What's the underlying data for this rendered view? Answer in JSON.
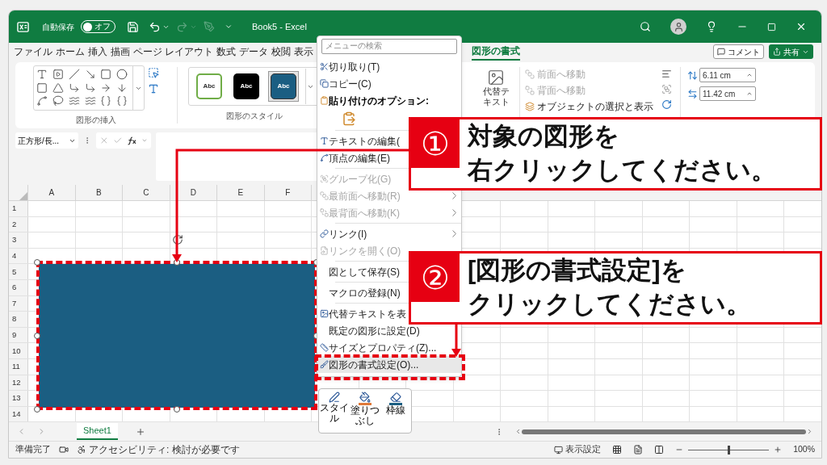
{
  "title_bar": {
    "autosave_label": "自動保存",
    "autosave_toggle": {
      "label": "オフ",
      "on": false
    },
    "title": "Book5 - Excel"
  },
  "ribbon_tabs": [
    {
      "label": "ファイル",
      "selected": false
    },
    {
      "label": "ホーム",
      "selected": false
    },
    {
      "label": "挿入",
      "selected": false
    },
    {
      "label": "描画",
      "selected": false
    },
    {
      "label": "ページ レイアウト",
      "selected": false
    },
    {
      "label": "数式",
      "selected": false
    },
    {
      "label": "データ",
      "selected": false
    },
    {
      "label": "校閲",
      "selected": false
    },
    {
      "label": "表示",
      "selected": false
    },
    {
      "label": "図形の書式",
      "selected": true
    }
  ],
  "header_buttons": {
    "comment": "コメント",
    "share": "共有"
  },
  "ribbon": {
    "insert_shapes_label": "図形の挿入",
    "shape_styles": [
      {
        "label": "Abc",
        "kind": "outline",
        "selected": false
      },
      {
        "label": "Abc",
        "kind": "black",
        "selected": false
      },
      {
        "label": "Abc",
        "kind": "filled",
        "selected": true
      }
    ],
    "shape_styles_label": "図形のスタイル",
    "alt_text": "代替テキスト",
    "arrange": [
      {
        "label": "前面へ移動",
        "disabled": true
      },
      {
        "label": "背面へ移動",
        "disabled": true
      },
      {
        "label": "オブジェクトの選択と表示",
        "disabled": false
      }
    ],
    "height": "6.11 cm",
    "width": "11.42 cm"
  },
  "formula_bar": {
    "name_box": "正方形/長..."
  },
  "sheet": {
    "columns": [
      "A",
      "B",
      "C",
      "D",
      "E",
      "F"
    ],
    "rows": [
      "1",
      "2",
      "3",
      "4",
      "5",
      "6",
      "7",
      "8",
      "9",
      "10",
      "11",
      "12",
      "13",
      "14"
    ]
  },
  "context_menu": {
    "search_placeholder": "メニューの検索",
    "items": [
      {
        "kind": "item",
        "label": "切り取り(T)",
        "disabled": false,
        "submenu": false,
        "selected": false
      },
      {
        "kind": "item",
        "label": "コピー(C)",
        "disabled": false,
        "submenu": false,
        "selected": false
      },
      {
        "kind": "header",
        "label": "貼り付けのオプション:"
      },
      {
        "kind": "paste"
      },
      {
        "kind": "separator"
      },
      {
        "kind": "item",
        "label": "テキストの編集(",
        "disabled": false,
        "selected": false
      },
      {
        "kind": "item",
        "label": "頂点の編集(E)",
        "disabled": false,
        "selected": false
      },
      {
        "kind": "separator"
      },
      {
        "kind": "item",
        "label": "グループ化(G)",
        "disabled": true,
        "submenu": false,
        "selected": false
      },
      {
        "kind": "item",
        "label": "最前面へ移動(R)",
        "disabled": true,
        "submenu": true,
        "selected": false
      },
      {
        "kind": "item",
        "label": "最背面へ移動(K)",
        "disabled": true,
        "submenu": true,
        "selected": false
      },
      {
        "kind": "separator"
      },
      {
        "kind": "item",
        "label": "リンク(I)",
        "disabled": false,
        "submenu": true,
        "selected": false
      },
      {
        "kind": "item",
        "label": "リンクを開く(O)",
        "disabled": true,
        "submenu": false,
        "selected": false
      },
      {
        "kind": "separator"
      },
      {
        "kind": "item",
        "label": "図として保存(S)",
        "disabled": false,
        "selected": false
      },
      {
        "kind": "separator"
      },
      {
        "kind": "item",
        "label": "マクロの登録(N)",
        "disabled": false,
        "selected": false
      },
      {
        "kind": "separator"
      },
      {
        "kind": "item",
        "label": "代替テキストを表",
        "disabled": false,
        "selected": false
      },
      {
        "kind": "item",
        "label": "既定の図形に設定(D)",
        "disabled": false,
        "selected": false
      },
      {
        "kind": "item",
        "label": "サイズとプロパティ(Z)...",
        "disabled": false,
        "submenu": false,
        "selected": false
      },
      {
        "kind": "item",
        "label": "図形の書式設定(O)...",
        "disabled": false,
        "submenu": false,
        "selected": true
      }
    ]
  },
  "mini_toolbar": [
    {
      "label": "スタイル"
    },
    {
      "label": "塗りつぶし"
    },
    {
      "label": "枠線"
    }
  ],
  "sheet_tabs": [
    {
      "label": "Sheet1",
      "selected": true
    }
  ],
  "status_bar": {
    "ready": "準備完了",
    "accessibility": "アクセシビリティ: 検討が必要です",
    "display_settings": "表示設定",
    "zoom_slider": {
      "level": 0.5
    },
    "zoom": "100%"
  },
  "callouts": [
    {
      "number": "①",
      "lines": [
        "対象の図形を",
        "右クリックしてください。"
      ]
    },
    {
      "number": "②",
      "lines": [
        "[図形の書式設定]を",
        "クリックしてください。"
      ]
    }
  ]
}
